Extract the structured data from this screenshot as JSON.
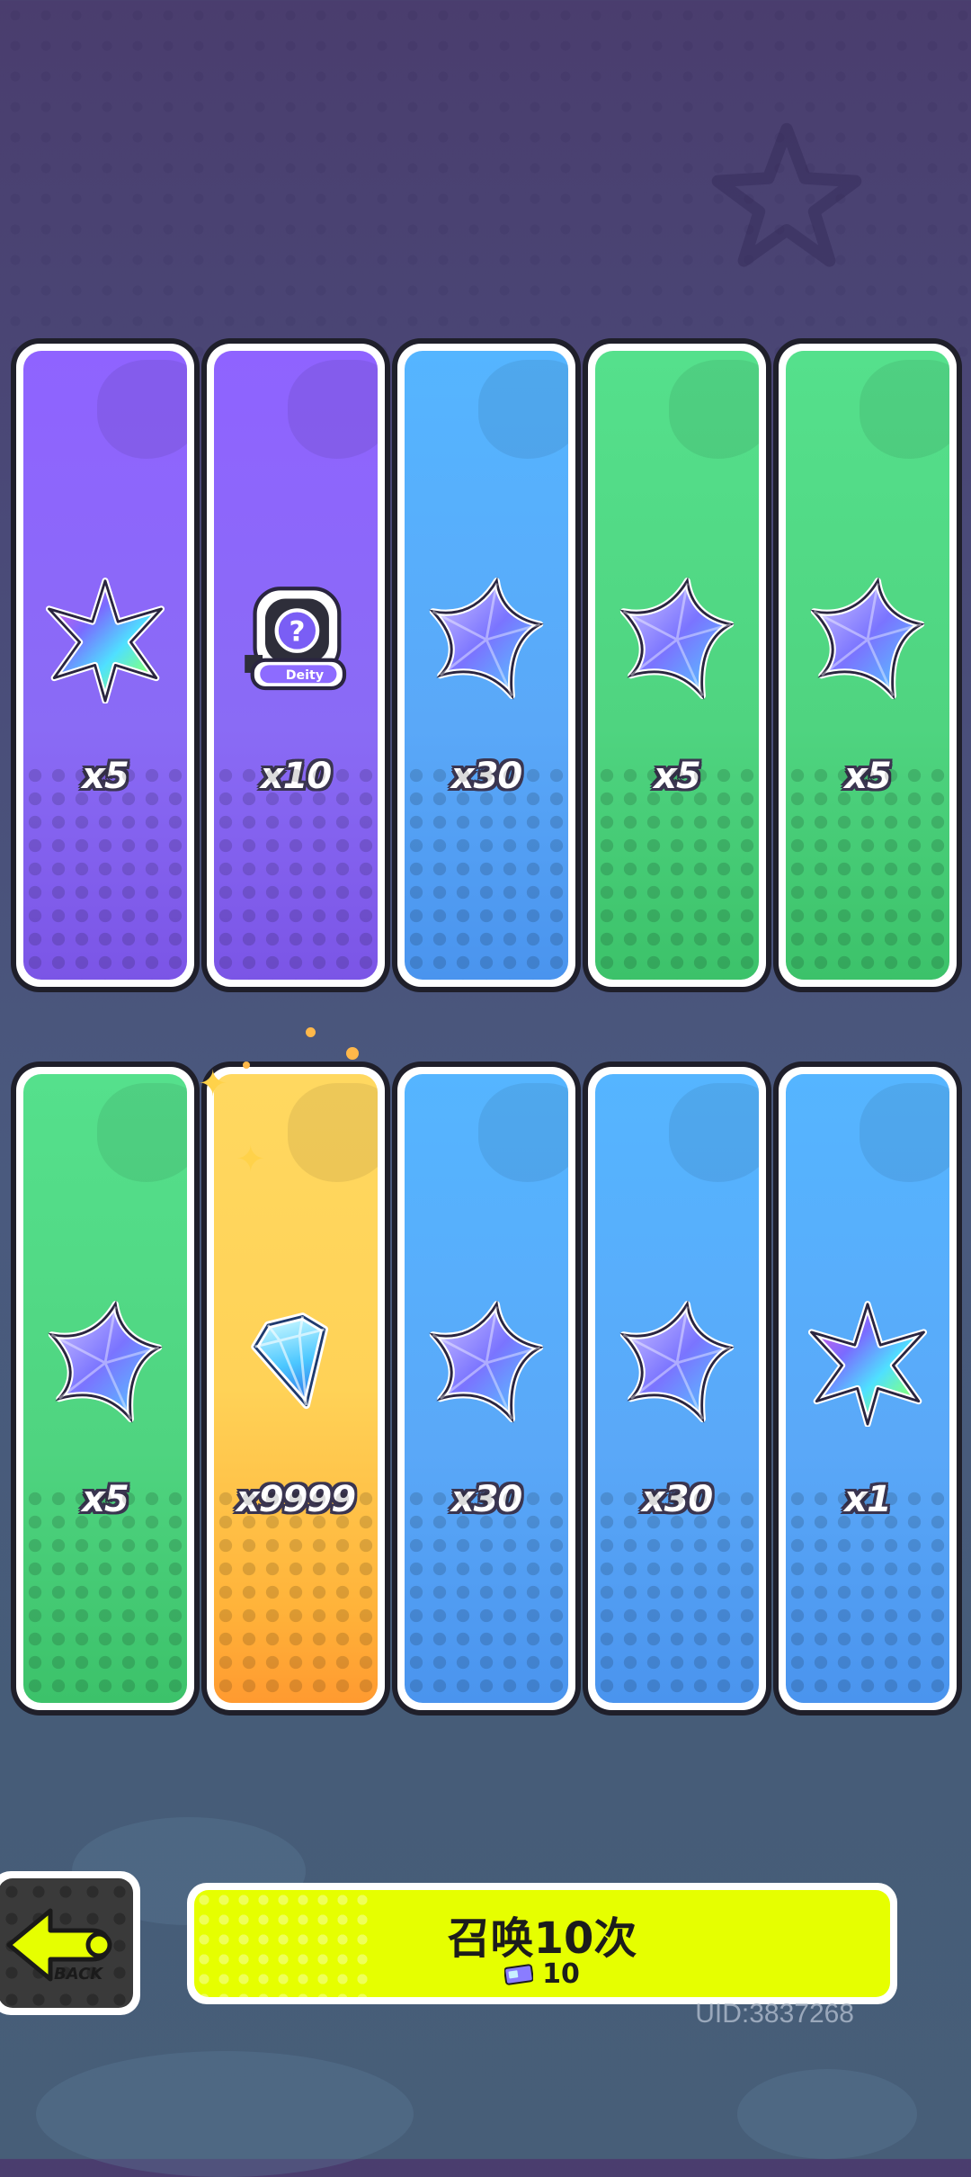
{
  "cards_row1": [
    {
      "color": "purple",
      "icon": "rainbow-star-icon",
      "count": "x5"
    },
    {
      "color": "purple",
      "icon": "mystery-deity-badge-icon",
      "count": "x10"
    },
    {
      "color": "blue",
      "icon": "blue-star-icon",
      "count": "x30"
    },
    {
      "color": "green",
      "icon": "blue-star-icon",
      "count": "x5"
    },
    {
      "color": "green",
      "icon": "blue-star-icon",
      "count": "x5"
    }
  ],
  "cards_row2": [
    {
      "color": "green",
      "icon": "blue-star-icon",
      "count": "x5"
    },
    {
      "color": "gold",
      "icon": "diamond-icon",
      "count": "x9999"
    },
    {
      "color": "blue",
      "icon": "blue-star-icon",
      "count": "x30"
    },
    {
      "color": "blue",
      "icon": "blue-star-icon",
      "count": "x30"
    },
    {
      "color": "blue",
      "icon": "rainbow-star-icon",
      "count": "x1"
    }
  ],
  "badge_text": "Deity",
  "back": {
    "label": "BACK"
  },
  "summon": {
    "label": "召唤10次",
    "cost": "10",
    "cost_icon": "ticket-icon"
  },
  "uid": "UID:3837268",
  "colors": {
    "purple": "#8f63ff",
    "blue": "#55b5ff",
    "green": "#55e08c",
    "gold": "#ffd860",
    "button": "#e6ff00"
  }
}
